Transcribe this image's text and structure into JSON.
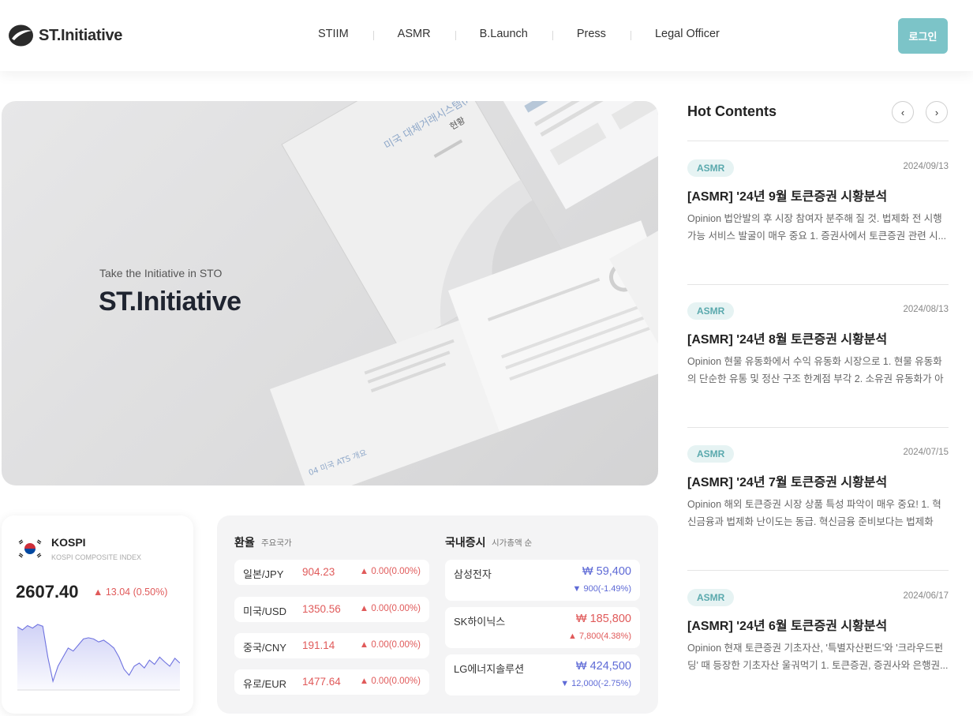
{
  "header": {
    "logo_text": "ST.Initiative",
    "nav": [
      "STIIM",
      "ASMR",
      "B.Launch",
      "Press",
      "Legal Officer"
    ],
    "login_label": "로그인"
  },
  "hero": {
    "subtitle": "Take the Initiative in STO",
    "title": "ST.Initiative",
    "book_title": "미국 대체거래시스템(ATS)",
    "book_subtitle": "현황",
    "booklet_heading": "04 미국 ATS 개요"
  },
  "hot": {
    "title": "Hot Contents",
    "prev_label": "‹",
    "next_label": "›",
    "items": [
      {
        "tag": "ASMR",
        "date": "2024/09/13",
        "title": "[ASMR] '24년 9월 토큰증권 시황분석",
        "desc": "Opinion 법안발의 후 시장 참여자 분주해 질 것. 법제화 전 시행 가능 서비스 발굴이 매우 중요 1. 증권사에서 토큰증권 관련 시..."
      },
      {
        "tag": "ASMR",
        "date": "2024/08/13",
        "title": "[ASMR] '24년 8월 토큰증권 시황분석",
        "desc": "Opinion 현물 유동화에서 수익 유동화 시장으로 1. 현물 유동화의 단순한 유통 및 정산 구조 한계점 부각 2. 소유권 유동화가 아닌..."
      },
      {
        "tag": "ASMR",
        "date": "2024/07/15",
        "title": "[ASMR] '24년 7월 토큰증권 시황분석",
        "desc": "Opinion 해외 토큰증권 시장 상품 특성 파악이 매우 중요! 1. 혁신금융과 법제화 난이도는 동급. 혁신금융 준비보다는 법제화 시..."
      },
      {
        "tag": "ASMR",
        "date": "2024/06/17",
        "title": "[ASMR] '24년 6월 토큰증권 시황분석",
        "desc": "Opinion 현재 토큰증권 기초자산, '특별자산펀드'와 '크라우드펀딩' 때 등장한 기초자산 울궈먹기 1. 토큰증권, 증권사와 은행권..."
      }
    ]
  },
  "kospi": {
    "name": "KOSPI",
    "subname": "KOSPI COMPOSITE INDEX",
    "value": "2607.40",
    "change": "▲ 13.04 (0.50%)",
    "series": [
      2610,
      2605,
      2612,
      2608,
      2614,
      2611,
      2560,
      2520,
      2545,
      2560,
      2575,
      2570,
      2580,
      2590,
      2592,
      2590,
      2585,
      2588,
      2582,
      2575,
      2560,
      2540,
      2530,
      2545,
      2550,
      2542,
      2555,
      2548,
      2560,
      2552,
      2545,
      2558,
      2550
    ]
  },
  "fx": {
    "title": "환율",
    "subtitle": "주요국가",
    "rows": [
      {
        "name": "일본/JPY",
        "value": "904.23",
        "change": "▲ 0.00(0.00%)"
      },
      {
        "name": "미국/USD",
        "value": "1350.56",
        "change": "▲ 0.00(0.00%)"
      },
      {
        "name": "중국/CNY",
        "value": "191.14",
        "change": "▲ 0.00(0.00%)"
      },
      {
        "name": "유로/EUR",
        "value": "1477.64",
        "change": "▲ 0.00(0.00%)"
      }
    ]
  },
  "stocks": {
    "title": "국내증시",
    "subtitle": "시가총액 순",
    "rows": [
      {
        "name": "삼성전자",
        "price": "₩ 59,400",
        "change": "▼ 900(-1.49%)",
        "dir": "down"
      },
      {
        "name": "SK하이닉스",
        "price": "₩ 185,800",
        "change": "▲ 7,800(4.38%)",
        "dir": "up"
      },
      {
        "name": "LG에너지솔루션",
        "price": "₩ 424,500",
        "change": "▼ 12,000(-2.75%)",
        "dir": "down"
      }
    ]
  },
  "colors": {
    "accent": "#7cc4c8",
    "up": "#e05a5a",
    "down": "#5e6ad6",
    "tag_bg": "#e6f3f3"
  }
}
